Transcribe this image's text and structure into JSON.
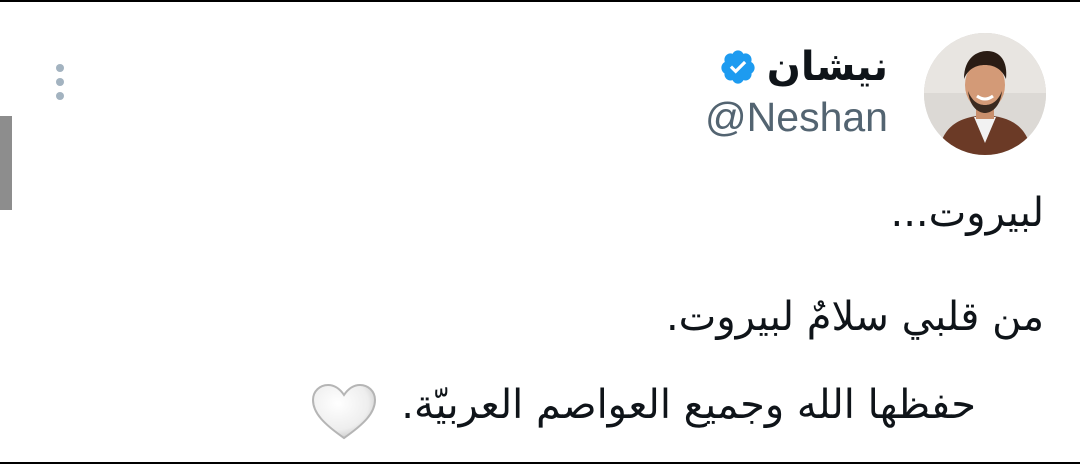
{
  "tweet": {
    "author": {
      "display_name": "نيشان",
      "handle": "@Neshan",
      "verified": true
    },
    "text_lines": [
      "لبيروت...",
      "من قلبي سلامٌ لبيروت.",
      "حفظها الله وجميع العواصم العربيّة."
    ],
    "emoji": "white-heart-icon"
  },
  "colors": {
    "verified_badge": "#1d9bf0",
    "handle": "#536471",
    "text": "#0f1419",
    "more_dots": "#a3b3c0"
  }
}
